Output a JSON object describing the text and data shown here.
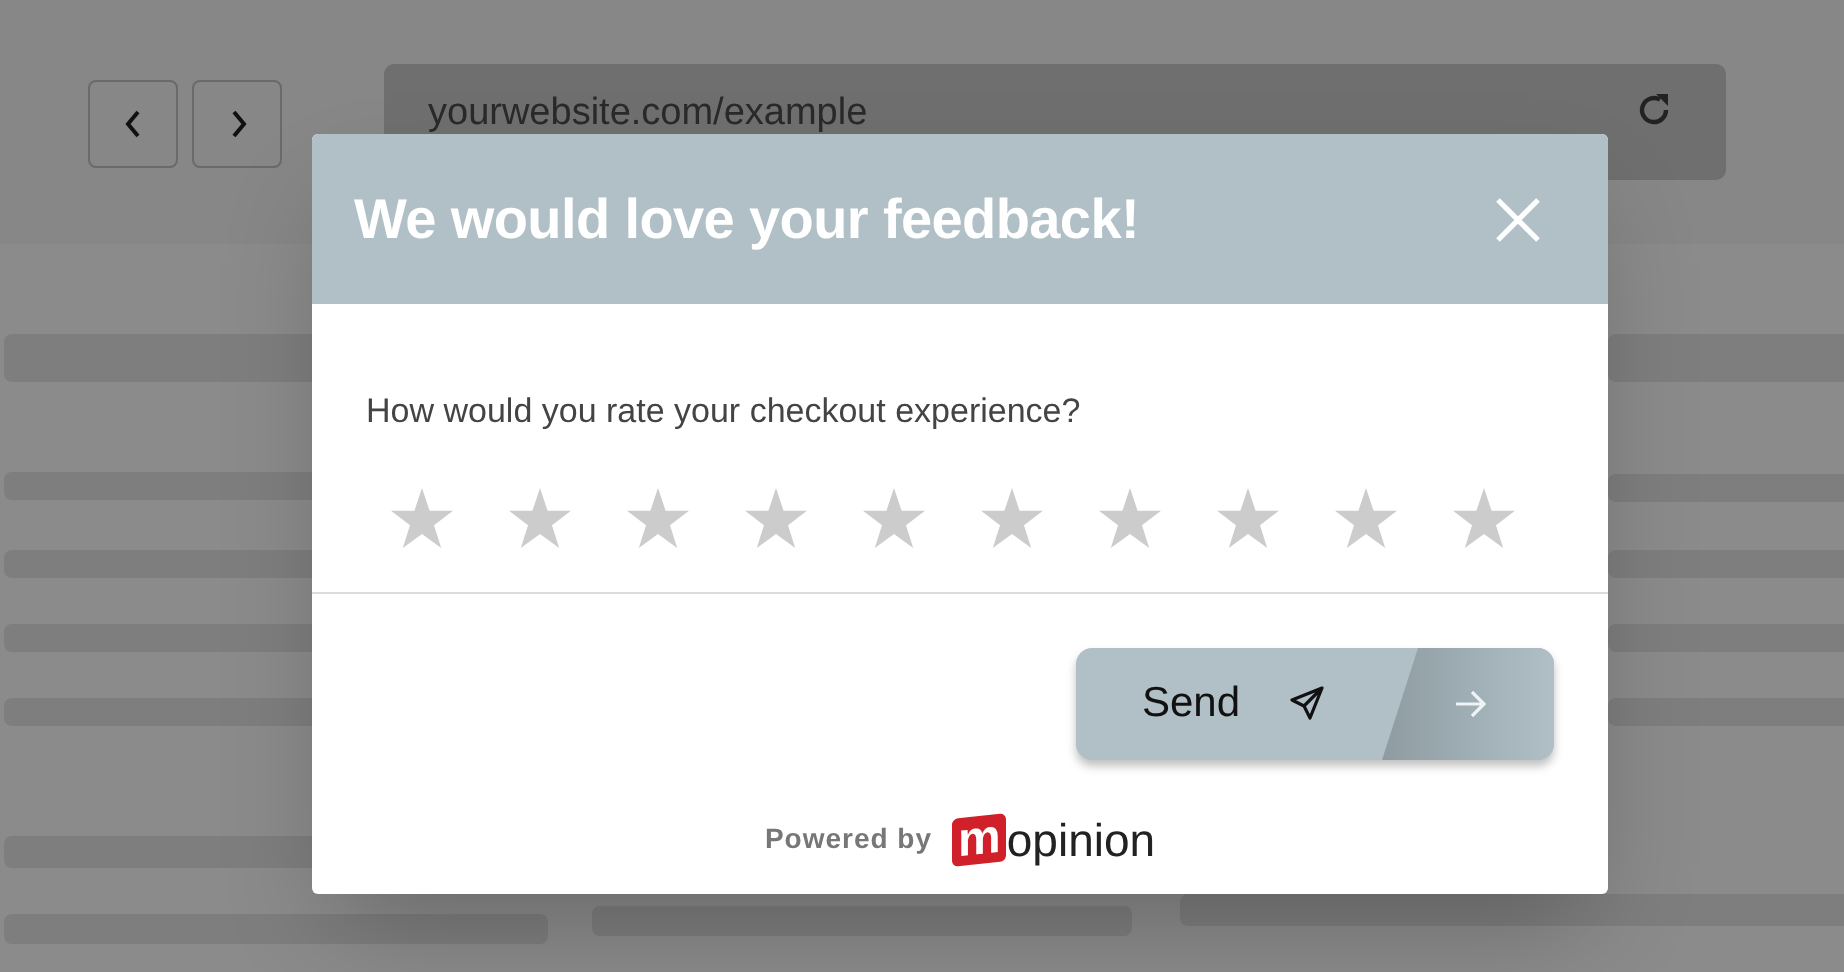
{
  "browser": {
    "url": "yourwebsite.com/example"
  },
  "dialog": {
    "title": "We would love your feedback!",
    "question": "How would you rate your checkout experience?",
    "rating": {
      "stars": 0
    },
    "send_button": {
      "label": "Send"
    },
    "footer": {
      "powered_by": "Powered by",
      "logo_mark": "m",
      "logo_text": "opinion"
    }
  }
}
